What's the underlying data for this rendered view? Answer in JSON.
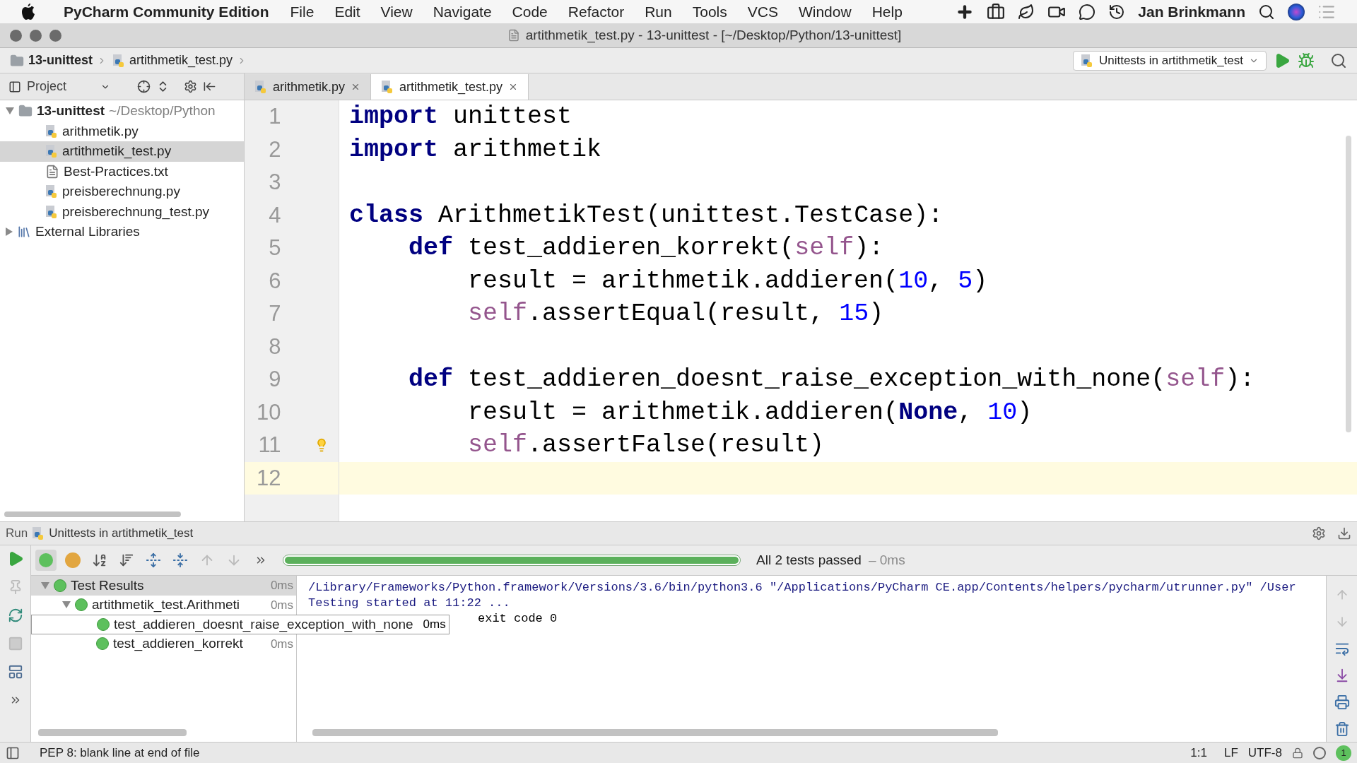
{
  "menu_bar": {
    "app_name": "PyCharm Community Edition",
    "menus": [
      "File",
      "Edit",
      "View",
      "Navigate",
      "Code",
      "Refactor",
      "Run",
      "Tools",
      "VCS",
      "Window",
      "Help"
    ],
    "user": "Jan Brinkmann"
  },
  "window": {
    "title": "artithmetik_test.py - 13-unittest - [~/Desktop/Python/13-unittest]"
  },
  "breadcrumbs": [
    "13-unittest",
    "artithmetik_test.py"
  ],
  "run_config": {
    "label": "Unittests in artithmetik_test"
  },
  "project_panel": {
    "title": "Project",
    "tree": [
      {
        "label": "13-unittest",
        "path": "~/Desktop/Python",
        "kind": "folder",
        "expanded": true,
        "selected": false,
        "children": [
          {
            "label": "arithmetik.py",
            "kind": "python",
            "selected": false
          },
          {
            "label": "artithmetik_test.py",
            "kind": "python",
            "selected": true
          },
          {
            "label": "Best-Practices.txt",
            "kind": "text",
            "selected": false
          },
          {
            "label": "preisberechnung.py",
            "kind": "python",
            "selected": false
          },
          {
            "label": "preisberechnung_test.py",
            "kind": "python",
            "selected": false
          }
        ]
      },
      {
        "label": "External Libraries",
        "kind": "library",
        "expanded": false,
        "selected": false
      }
    ]
  },
  "editor_tabs": [
    {
      "label": "arithmetik.py",
      "selected": false
    },
    {
      "label": "artithmetik_test.py",
      "selected": true
    }
  ],
  "editor": {
    "lines": [
      {
        "number": "1",
        "current": false,
        "bulb": false,
        "tokens": [
          {
            "kind": "keyword",
            "text": "import"
          },
          {
            "kind": "name",
            "text": " unittest"
          }
        ]
      },
      {
        "number": "2",
        "current": false,
        "bulb": false,
        "tokens": [
          {
            "kind": "keyword",
            "text": "import"
          },
          {
            "kind": "name",
            "text": " arithmetik"
          }
        ]
      },
      {
        "number": "3",
        "current": false,
        "bulb": false
      },
      {
        "number": "4",
        "current": false,
        "bulb": false,
        "tokens": [
          {
            "kind": "keyword",
            "text": "class"
          },
          {
            "kind": "name",
            "text": " ArithmetikTest(unittest.TestCase):"
          }
        ]
      },
      {
        "number": "5",
        "current": false,
        "bulb": false,
        "tokens": [
          {
            "kind": "keyword",
            "text": "    def"
          },
          {
            "kind": "name",
            "text": " test_addieren_korrekt("
          },
          {
            "kind": "self",
            "text": "self"
          },
          {
            "kind": "name",
            "text": "):"
          }
        ]
      },
      {
        "number": "6",
        "current": false,
        "bulb": false,
        "tokens": [
          {
            "kind": "name",
            "text": "        result = arithmetik.addieren("
          },
          {
            "kind": "number",
            "text": "10"
          },
          {
            "kind": "name",
            "text": ", "
          },
          {
            "kind": "number",
            "text": "5"
          },
          {
            "kind": "name",
            "text": ")"
          }
        ]
      },
      {
        "number": "7",
        "current": false,
        "bulb": false,
        "tokens": [
          {
            "kind": "self",
            "text": "        self"
          },
          {
            "kind": "name",
            "text": ".assertEqual(result, "
          },
          {
            "kind": "number",
            "text": "15"
          },
          {
            "kind": "name",
            "text": ")"
          }
        ]
      },
      {
        "number": "8",
        "current": false,
        "bulb": false
      },
      {
        "number": "9",
        "current": false,
        "bulb": false,
        "tokens": [
          {
            "kind": "keyword",
            "text": "    def"
          },
          {
            "kind": "name",
            "text": " test_addieren_doesnt_raise_exception_with_none("
          },
          {
            "kind": "self",
            "text": "self"
          },
          {
            "kind": "name",
            "text": "):"
          }
        ]
      },
      {
        "number": "10",
        "current": false,
        "bulb": false,
        "tokens": [
          {
            "kind": "name",
            "text": "        result = arithmetik.addieren("
          },
          {
            "kind": "keyword",
            "text": "None"
          },
          {
            "kind": "name",
            "text": ", "
          },
          {
            "kind": "number",
            "text": "10"
          },
          {
            "kind": "name",
            "text": ")"
          }
        ]
      },
      {
        "number": "11",
        "current": false,
        "bulb": true,
        "tokens": [
          {
            "kind": "self",
            "text": "        self"
          },
          {
            "kind": "name",
            "text": ".assertFalse(result)"
          }
        ]
      },
      {
        "number": "12",
        "current": true,
        "bulb": false
      }
    ]
  },
  "run_panel": {
    "title": "Run",
    "config": "Unittests in artithmetik_test",
    "progress": {
      "level": 1
    },
    "status": "All 2 tests passed",
    "duration": "– 0ms",
    "tree": [
      {
        "label": "Test Results",
        "time": "0ms",
        "expanded": true,
        "selected": true,
        "hovered": false,
        "children": [
          {
            "label": "artithmetik_test.Arithmeti",
            "time": "0ms",
            "expanded": true,
            "selected": false,
            "hovered": false,
            "children": [
              {
                "label": "test_addieren_doesnt_raise_exception_with_none",
                "time": "0ms",
                "selected": false,
                "hovered": true
              },
              {
                "label": "test_addieren_korrekt",
                "time": "0ms",
                "selected": false,
                "hovered": false
              }
            ]
          }
        ]
      }
    ],
    "console": [
      {
        "kind": "line",
        "text": "/Library/Frameworks/Python.framework/Versions/3.6/bin/python3.6 \"/Applications/PyCharm CE.app/Contents/helpers/pycharm/utrunner.py\" /User"
      },
      {
        "kind": "line",
        "text": "Testing started at 11:22 ..."
      },
      {
        "kind": "covered",
        "text": "exit code 0"
      }
    ]
  },
  "status_bar": {
    "message": "PEP 8: blank line at end of file",
    "position": "1:1",
    "line_separator": "LF",
    "encoding": "UTF-8",
    "notifications": "1"
  }
}
